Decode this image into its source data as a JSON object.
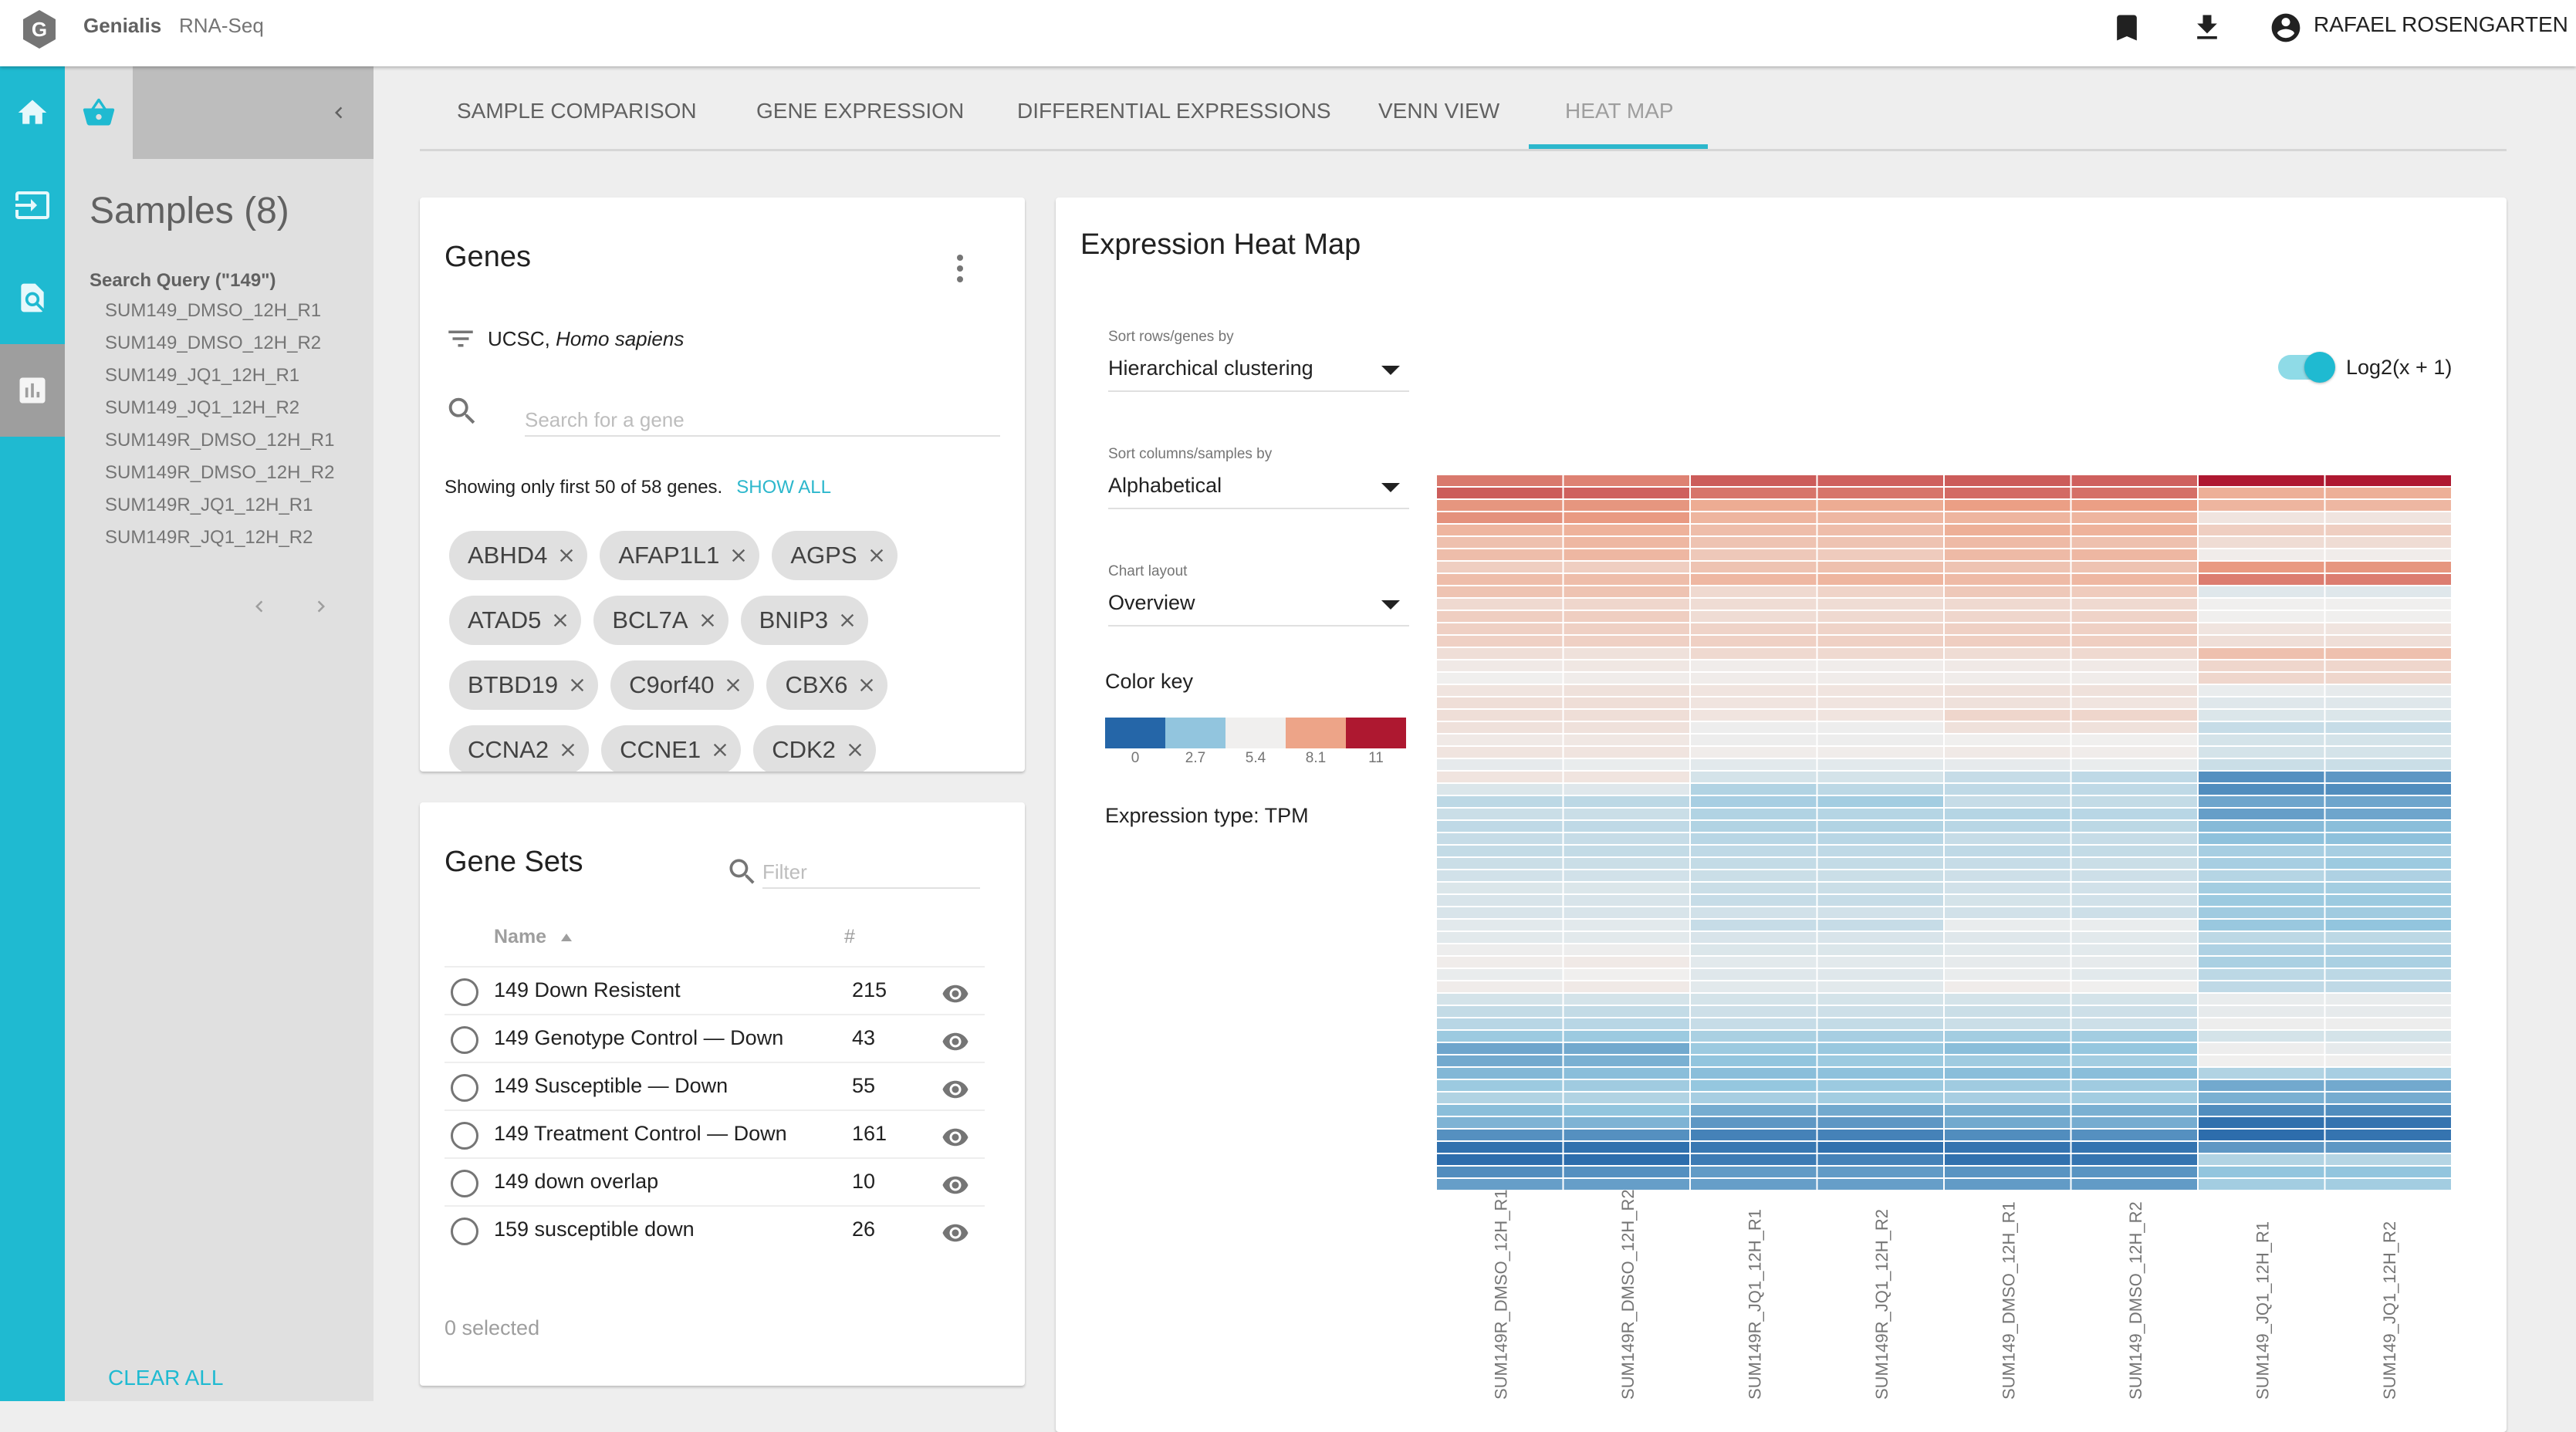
{
  "header": {
    "logo_letter": "G",
    "brand": "Genialis",
    "product": "RNA-Seq",
    "user_name": "RAFAEL ROSENGARTEN",
    "icons": [
      "bookmark-icon",
      "download-icon",
      "account-circle-icon"
    ]
  },
  "rail": {
    "items": [
      {
        "name": "home",
        "icon": "home-icon",
        "active": false
      },
      {
        "name": "import",
        "icon": "input-icon",
        "active": false
      },
      {
        "name": "search-samples",
        "icon": "find-in-page-icon",
        "active": false
      },
      {
        "name": "analysis",
        "icon": "bar-chart-icon",
        "active": true
      }
    ]
  },
  "samples_panel": {
    "title": "Samples (8)",
    "query_label": "Search Query (\"149\")",
    "samples": [
      "SUM149_DMSO_12H_R1",
      "SUM149_DMSO_12H_R2",
      "SUM149_JQ1_12H_R1",
      "SUM149_JQ1_12H_R2",
      "SUM149R_DMSO_12H_R1",
      "SUM149R_DMSO_12H_R2",
      "SUM149R_JQ1_12H_R1",
      "SUM149R_JQ1_12H_R2"
    ],
    "clear_all": "CLEAR ALL"
  },
  "tabs": [
    {
      "label": "SAMPLE COMPARISON",
      "active": false
    },
    {
      "label": "GENE EXPRESSION",
      "active": false
    },
    {
      "label": "DIFFERENTIAL EXPRESSIONS",
      "active": false
    },
    {
      "label": "VENN VIEW",
      "active": false
    },
    {
      "label": "HEAT MAP",
      "active": true
    }
  ],
  "genes": {
    "title": "Genes",
    "source": "UCSC,",
    "species": "Homo sapiens",
    "search_placeholder": "Search for a gene",
    "search_value": "",
    "showing": "Showing only first 50 of 58 genes.",
    "show_all": "SHOW ALL",
    "chips": [
      "ABHD4",
      "AFAP1L1",
      "AGPS",
      "ATAD5",
      "BCL7A",
      "BNIP3",
      "BTBD19",
      "C9orf40",
      "CBX6",
      "CCNA2",
      "CCNE1",
      "CDK2"
    ]
  },
  "gene_sets": {
    "title": "Gene Sets",
    "filter_placeholder": "Filter",
    "filter_value": "",
    "col_name": "Name",
    "col_count": "#",
    "rows": [
      {
        "name": "149 Down Resistent",
        "count": "215"
      },
      {
        "name": "149 Genotype Control — Down",
        "count": "43"
      },
      {
        "name": "149 Susceptible — Down",
        "count": "55"
      },
      {
        "name": "149 Treatment Control — Down",
        "count": "161"
      },
      {
        "name": "149 down overlap",
        "count": "10"
      },
      {
        "name": "159 susceptible down",
        "count": "26"
      }
    ],
    "selected": "0 selected"
  },
  "heatmap_panel": {
    "title": "Expression Heat Map",
    "sort_rows_label": "Sort rows/genes by",
    "sort_rows_value": "Hierarchical clustering",
    "sort_cols_label": "Sort columns/samples by",
    "sort_cols_value": "Alphabetical",
    "layout_label": "Chart layout",
    "layout_value": "Overview",
    "color_key_title": "Color key",
    "expression_type": "Expression type: TPM",
    "log_toggle_label": "Log2(x + 1)",
    "log_toggle_on": true
  },
  "chart_data": {
    "type": "heatmap",
    "title": "Expression Heat Map",
    "color_scale": {
      "stops": [
        0,
        2.7,
        5.4,
        8.1,
        11
      ],
      "labels": [
        "0",
        "2.7",
        "5.4",
        "8.1",
        "11"
      ],
      "colors": [
        "#2566a8",
        "#92c5de",
        "#f0efee",
        "#eda488",
        "#ae1830"
      ]
    },
    "columns": [
      "SUM149R_DMSO_12H_R1",
      "SUM149R_DMSO_12H_R2",
      "SUM149R_JQ1_12H_R1",
      "SUM149R_JQ1_12H_R2",
      "SUM149_DMSO_12H_R1",
      "SUM149_DMSO_12H_R2",
      "SUM149_JQ1_12H_R1",
      "SUM149_JQ1_12H_R2"
    ],
    "n_rows": 58,
    "values": [
      [
        9.0,
        8.8,
        9.6,
        9.5,
        9.6,
        9.5,
        11.0,
        11.0
      ],
      [
        9.6,
        9.5,
        9.1,
        9.1,
        9.3,
        9.2,
        7.7,
        7.7
      ],
      [
        8.4,
        8.4,
        7.8,
        7.8,
        8.2,
        8.2,
        7.5,
        7.4
      ],
      [
        8.5,
        8.3,
        7.5,
        7.4,
        7.5,
        7.5,
        5.8,
        5.8
      ],
      [
        7.5,
        7.6,
        7.2,
        7.2,
        7.7,
        7.6,
        6.6,
        6.6
      ],
      [
        7.1,
        7.4,
        7.0,
        7.0,
        7.3,
        7.1,
        6.1,
        6.1
      ],
      [
        7.2,
        7.4,
        6.8,
        6.7,
        7.3,
        7.4,
        5.5,
        5.5
      ],
      [
        6.6,
        6.6,
        7.0,
        7.1,
        7.0,
        7.0,
        8.3,
        8.4
      ],
      [
        7.2,
        7.2,
        7.4,
        7.5,
        7.3,
        7.4,
        8.9,
        8.9
      ],
      [
        7.0,
        7.0,
        6.2,
        6.4,
        6.8,
        6.7,
        4.9,
        4.9
      ],
      [
        6.2,
        6.3,
        6.1,
        6.1,
        6.2,
        6.2,
        5.4,
        5.4
      ],
      [
        6.6,
        6.6,
        6.1,
        6.2,
        6.3,
        6.4,
        5.4,
        5.4
      ],
      [
        6.5,
        6.5,
        6.4,
        6.4,
        6.5,
        6.5,
        5.8,
        5.8
      ],
      [
        6.5,
        6.5,
        6.5,
        6.5,
        6.6,
        6.6,
        6.0,
        6.0
      ],
      [
        6.0,
        5.9,
        6.2,
        6.2,
        6.1,
        6.2,
        7.1,
        7.1
      ],
      [
        5.6,
        5.7,
        5.5,
        5.5,
        5.6,
        5.6,
        6.3,
        6.3
      ],
      [
        5.4,
        5.5,
        5.5,
        5.5,
        5.5,
        5.5,
        6.3,
        6.3
      ],
      [
        5.8,
        5.9,
        5.8,
        5.8,
        5.9,
        5.9,
        5.2,
        5.1
      ],
      [
        6.0,
        6.0,
        5.8,
        5.8,
        5.9,
        5.8,
        4.9,
        4.9
      ],
      [
        6.0,
        6.0,
        5.8,
        5.8,
        6.3,
        6.3,
        4.8,
        4.8
      ],
      [
        5.9,
        5.9,
        5.3,
        5.3,
        5.9,
        5.9,
        4.2,
        4.2
      ],
      [
        5.6,
        5.7,
        5.3,
        5.3,
        5.4,
        5.4,
        4.6,
        4.6
      ],
      [
        5.8,
        5.8,
        5.5,
        5.5,
        5.6,
        5.5,
        4.6,
        4.6
      ],
      [
        5.1,
        5.2,
        5.0,
        5.0,
        5.1,
        5.2,
        4.3,
        4.3
      ],
      [
        5.8,
        5.8,
        4.6,
        4.6,
        4.2,
        4.0,
        1.2,
        1.4
      ],
      [
        4.8,
        4.9,
        3.6,
        3.9,
        4.0,
        4.0,
        1.1,
        1.1
      ],
      [
        3.9,
        3.9,
        3.3,
        3.2,
        4.2,
        4.1,
        1.8,
        1.8
      ],
      [
        4.3,
        4.3,
        3.6,
        3.7,
        3.7,
        3.8,
        1.6,
        1.8
      ],
      [
        4.0,
        4.0,
        3.6,
        3.6,
        3.8,
        3.9,
        2.4,
        2.5
      ],
      [
        4.2,
        4.2,
        3.8,
        3.8,
        4.2,
        4.2,
        2.6,
        2.6
      ],
      [
        4.1,
        4.1,
        4.0,
        4.0,
        4.0,
        4.1,
        3.3,
        3.3
      ],
      [
        4.3,
        4.3,
        4.1,
        4.1,
        4.2,
        4.3,
        3.3,
        3.0
      ],
      [
        4.5,
        4.5,
        4.3,
        4.3,
        4.4,
        4.4,
        3.7,
        3.5
      ],
      [
        4.8,
        4.8,
        4.3,
        4.3,
        4.5,
        4.5,
        3.2,
        3.2
      ],
      [
        4.7,
        4.7,
        4.2,
        4.2,
        4.6,
        4.5,
        3.0,
        3.0
      ],
      [
        4.7,
        4.7,
        4.5,
        4.5,
        4.5,
        4.4,
        3.1,
        3.1
      ],
      [
        5.0,
        5.0,
        4.2,
        4.2,
        5.2,
        5.2,
        2.9,
        2.7
      ],
      [
        5.0,
        5.0,
        4.7,
        4.7,
        4.9,
        5.0,
        3.9,
        3.9
      ],
      [
        5.3,
        5.3,
        4.8,
        4.8,
        5.0,
        5.0,
        3.5,
        3.5
      ],
      [
        5.5,
        5.6,
        5.0,
        5.0,
        5.1,
        5.1,
        3.4,
        3.4
      ],
      [
        5.2,
        5.4,
        4.9,
        4.9,
        5.2,
        5.0,
        3.9,
        3.9
      ],
      [
        5.5,
        5.6,
        5.0,
        5.0,
        5.5,
        5.4,
        4.0,
        4.0
      ],
      [
        4.6,
        4.6,
        4.6,
        4.6,
        4.6,
        4.6,
        5.2,
        5.2
      ],
      [
        4.1,
        4.1,
        4.4,
        4.4,
        4.3,
        4.4,
        5.1,
        5.1
      ],
      [
        3.8,
        3.8,
        4.2,
        4.1,
        4.3,
        4.4,
        5.3,
        5.3
      ],
      [
        3.0,
        3.0,
        3.4,
        3.3,
        3.2,
        3.2,
        4.6,
        4.6
      ],
      [
        1.8,
        1.9,
        3.0,
        2.9,
        2.5,
        2.8,
        5.3,
        5.1
      ],
      [
        1.9,
        2.1,
        2.7,
        3.0,
        3.1,
        3.2,
        5.4,
        5.4
      ],
      [
        2.3,
        2.5,
        2.5,
        2.6,
        2.5,
        2.5,
        3.6,
        3.3
      ],
      [
        3.0,
        3.1,
        2.8,
        3.0,
        3.1,
        3.1,
        1.9,
        1.9
      ],
      [
        3.6,
        3.6,
        3.3,
        3.2,
        3.3,
        3.2,
        2.1,
        2.0
      ],
      [
        2.5,
        2.7,
        2.0,
        1.9,
        2.1,
        2.1,
        1.1,
        1.1
      ],
      [
        2.2,
        2.2,
        1.4,
        1.4,
        1.9,
        2.0,
        0.3,
        0.4
      ],
      [
        1.2,
        1.2,
        0.8,
        0.8,
        1.1,
        1.2,
        0.2,
        0.4
      ],
      [
        0.3,
        0.3,
        0.5,
        0.3,
        0.4,
        0.4,
        1.4,
        1.4
      ],
      [
        0.2,
        0.2,
        0.6,
        0.8,
        0.3,
        0.4,
        3.6,
        3.7
      ],
      [
        1.1,
        1.2,
        1.5,
        1.5,
        1.3,
        1.3,
        2.7,
        2.7
      ],
      [
        1.6,
        1.6,
        1.6,
        1.6,
        1.5,
        1.5,
        3.2,
        3.2
      ]
    ]
  }
}
